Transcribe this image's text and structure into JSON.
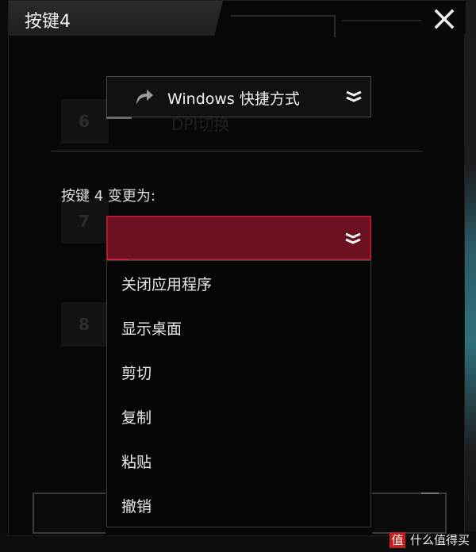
{
  "dialog": {
    "title": "按键4",
    "close_icon": "close-icon"
  },
  "background": {
    "ghost_keys": [
      "6",
      "7",
      "8"
    ],
    "ghost_label": "DPI切换"
  },
  "function_type": {
    "icon": "shortcut-arrow-icon",
    "label": "Windows 快捷方式",
    "expand_icon": "double-chevron-down-icon"
  },
  "assignment": {
    "label": "按键 4 变更为:",
    "selected_value": "",
    "expand_icon": "double-chevron-down-icon",
    "options": [
      "关闭应用程序",
      "显示桌面",
      "剪切",
      "复制",
      "粘贴",
      "撤销"
    ]
  },
  "watermark": {
    "badge": "值",
    "text": "什么值得买"
  },
  "colors": {
    "accent_red": "#6a1020",
    "accent_border": "#b01a33",
    "background": "#070707"
  }
}
